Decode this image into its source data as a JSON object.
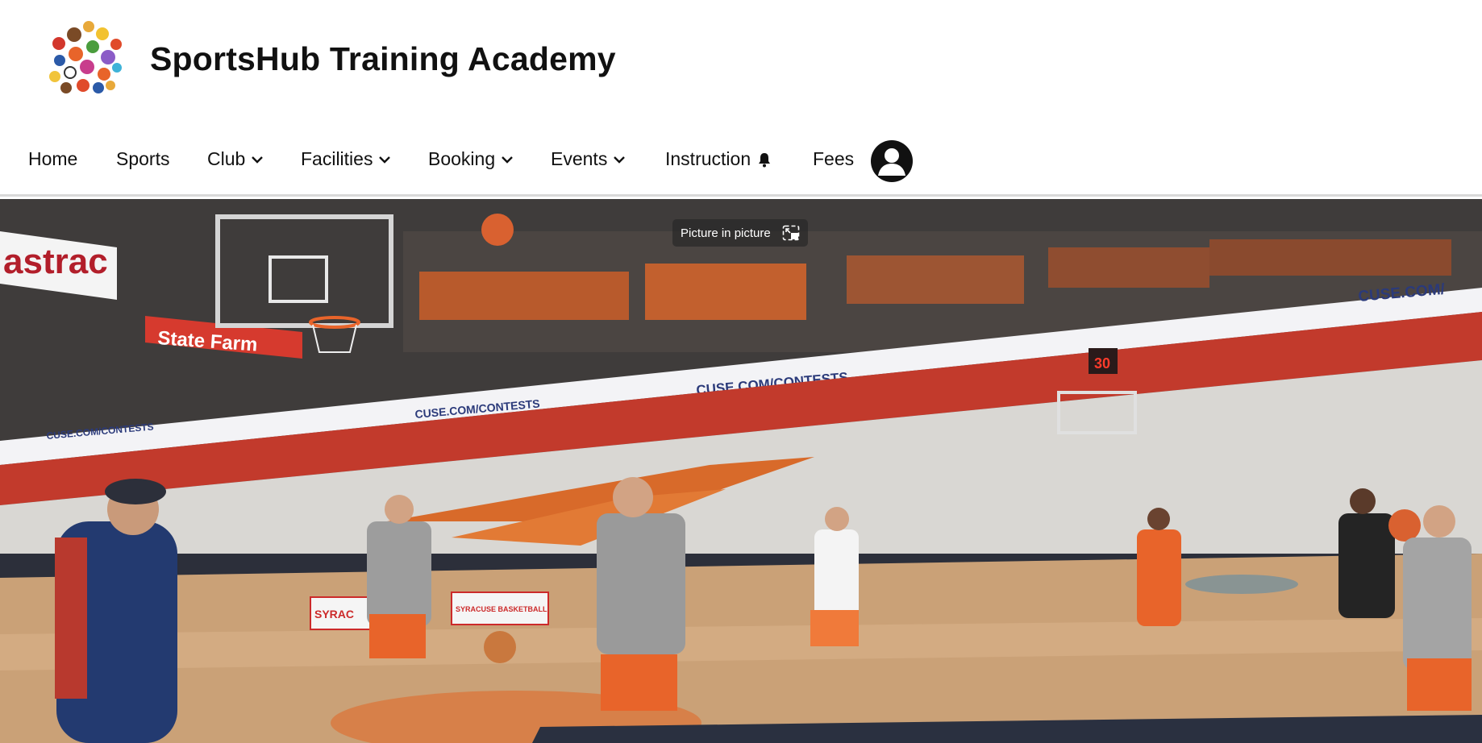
{
  "site": {
    "title": "SportsHub Training Academy",
    "logo_icon": "sports-balls-collage-icon"
  },
  "nav": {
    "items": [
      {
        "label": "Home",
        "has_dropdown": false
      },
      {
        "label": "Sports",
        "has_dropdown": false
      },
      {
        "label": "Club",
        "has_dropdown": true
      },
      {
        "label": "Facilities",
        "has_dropdown": true
      },
      {
        "label": "Booking",
        "has_dropdown": true
      },
      {
        "label": "Events",
        "has_dropdown": true
      },
      {
        "label": "Instruction",
        "has_dropdown": false,
        "icon": "bell-icon"
      },
      {
        "label": "Fees",
        "has_dropdown": false
      }
    ],
    "account_icon": "user-account-icon"
  },
  "video": {
    "pip_label": "Picture in picture",
    "pip_icon": "picture-in-picture-icon",
    "scene_text": {
      "board_left": "astrac",
      "sponsor_banner": "State Farm",
      "ribbon_main": "CUSE.COM/CONTESTS",
      "ribbon_right": "CUSE.COM/",
      "ribbon_left": "CUSE.COM/CONTESTS",
      "ribbon_far_left": "CUSE.COM/CONTESTS",
      "courtside_board": "SYRACUSE BASKETBALL",
      "courtside_board_left": "SYRAC",
      "shot_clock": "30"
    }
  },
  "colors": {
    "accent_orange": "#e8642a",
    "nav_text": "#111111",
    "header_bg": "#ffffff",
    "divider": "#d9d9d9"
  }
}
